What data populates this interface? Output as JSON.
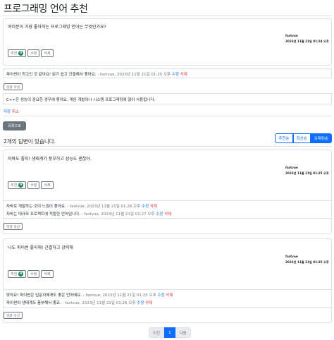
{
  "page_title": "프로그래밍 언어 추천",
  "question": {
    "content": "여러분이 가장 좋아하는 프로그래밍 언어는 무엇인가요?",
    "author": "fastvue",
    "date": "2023년 11월 21일 01:24 오후",
    "vote_label": "추천",
    "vote_count": "0",
    "edit_label": "수정",
    "delete_label": "삭제",
    "comments": [
      {
        "text": "파이썬이 최고인 것 같아요! 읽기 쉽고 간결해서 좋아요.",
        "meta": " - fastvue, 2023년 11월 21일 01:25 오후",
        "edit": "수정",
        "delete": "삭제"
      }
    ],
    "add_comment_label": "댓글 작성",
    "comment_input_value": "C++은 성능이 중요한 경우에 좋아요. 게임 개발이나 시스템 프로그래밍에 많이 사용됩니다.",
    "save_label": "저장",
    "cancel_label": "취소"
  },
  "list_button_label": "목록으로",
  "answers_count_text": "2개의 답변이 있습니다.",
  "sort_options": [
    "추천순",
    "최신순",
    "오래된순"
  ],
  "sort_active_index": 2,
  "answers": [
    {
      "content": "자바도 좋지! 생태계가 풍부하고 성능도 괜찮아.",
      "author": "fastvue",
      "date": "2023년 11월 21일 01:25 오후",
      "vote_label": "추천",
      "vote_count": "0",
      "edit_label": "수정",
      "delete_label": "삭제",
      "comments": [
        {
          "text": "자바로 개발하는 것이 느낌이 좋아요.",
          "meta": " - fastvue, 2023년 11월 21일 01:26 오후",
          "edit": "수정",
          "delete": "삭제"
        },
        {
          "text": "자바는 대규모 프로젝트에 적합한 언어입니다.",
          "meta": " - fastvue, 2023년 11월 21일 01:27 오후",
          "edit": "수정",
          "delete": "삭제"
        }
      ],
      "add_comment_label": "댓글 작성"
    },
    {
      "content": "나도 파이썬 좋아해! 간결하고 강력해",
      "author": "fastvue",
      "date": "2023년 11월 21일 01:25 오후",
      "vote_label": "추천",
      "vote_count": "0",
      "edit_label": "수정",
      "delete_label": "삭제",
      "comments": [
        {
          "text": "맞아요! 파이썬은 입문자에게도 좋은 언어에요.",
          "meta": " - fastvue, 2023년 11월 21일 01:25 오후",
          "edit": "수정",
          "delete": "삭제"
        },
        {
          "text": "파이썬의 생태계도 풍부해서 좋죠.",
          "meta": " - fastvue, 2023년 11월 21일 01:26 오후",
          "edit": "수정",
          "delete": "삭제"
        }
      ],
      "add_comment_label": "댓글 작성"
    }
  ],
  "pagination": {
    "prev": "이전",
    "current": "1",
    "next": "다음"
  }
}
